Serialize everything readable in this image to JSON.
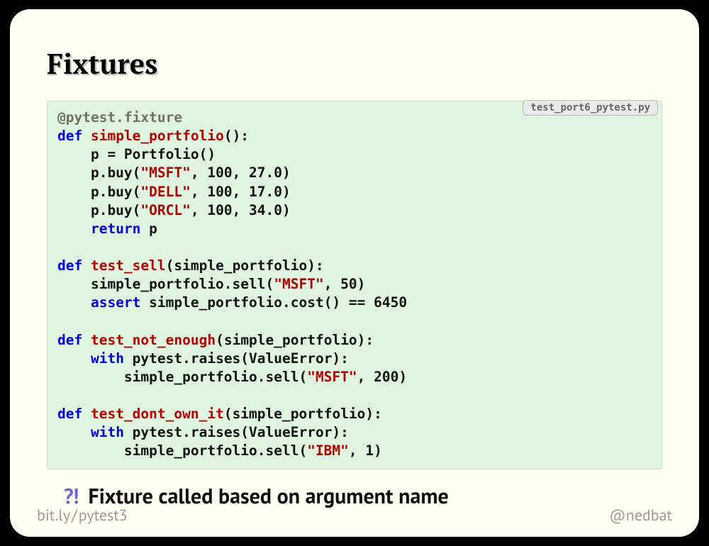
{
  "title": "Fixtures",
  "filename": "test_port6_pytest.py",
  "code": {
    "decorator": "@pytest.fixture",
    "def": "def",
    "ret": "return",
    "assrt": "assert",
    "wth": "with",
    "fn_fixture": "simple_portfolio",
    "fn_sell": "test_sell",
    "fn_notenough": "test_not_enough",
    "fn_dontown": "test_dont_own_it",
    "s_msft": "\"MSFT\"",
    "s_dell": "\"DELL\"",
    "s_orcl": "\"ORCL\"",
    "s_ibm": "\"IBM\"",
    "line_p": "    p = Portfolio()",
    "line_buy1_a": "    p.buy(",
    "line_buy1_b": ", 100, 27.0)",
    "line_buy2_a": "    p.buy(",
    "line_buy2_b": ", 100, 17.0)",
    "line_buy3_a": "    p.buy(",
    "line_buy3_b": ", 100, 34.0)",
    "line_ret_tail": " p",
    "sell_sig": "(simple_portfolio):",
    "sell_call_a": "    simple_portfolio.sell(",
    "sell_call_b": ", 50)",
    "assert_tail": " simple_portfolio.cost() == 6450",
    "ne_sig": "(simple_portfolio):",
    "raises_tail": " pytest.raises(ValueError):",
    "ne_call_a": "        simple_portfolio.sell(",
    "ne_call_b": ", 200)",
    "do_sig": "(simple_portfolio):",
    "do_call_a": "        simple_portfolio.sell(",
    "do_call_b": ", 1)"
  },
  "bullet": {
    "mark": "?!",
    "text": "Fixture called based on argument name"
  },
  "footer": {
    "left_a": "bit.ly",
    "left_b": "pytest3",
    "right": "@nedbat"
  }
}
